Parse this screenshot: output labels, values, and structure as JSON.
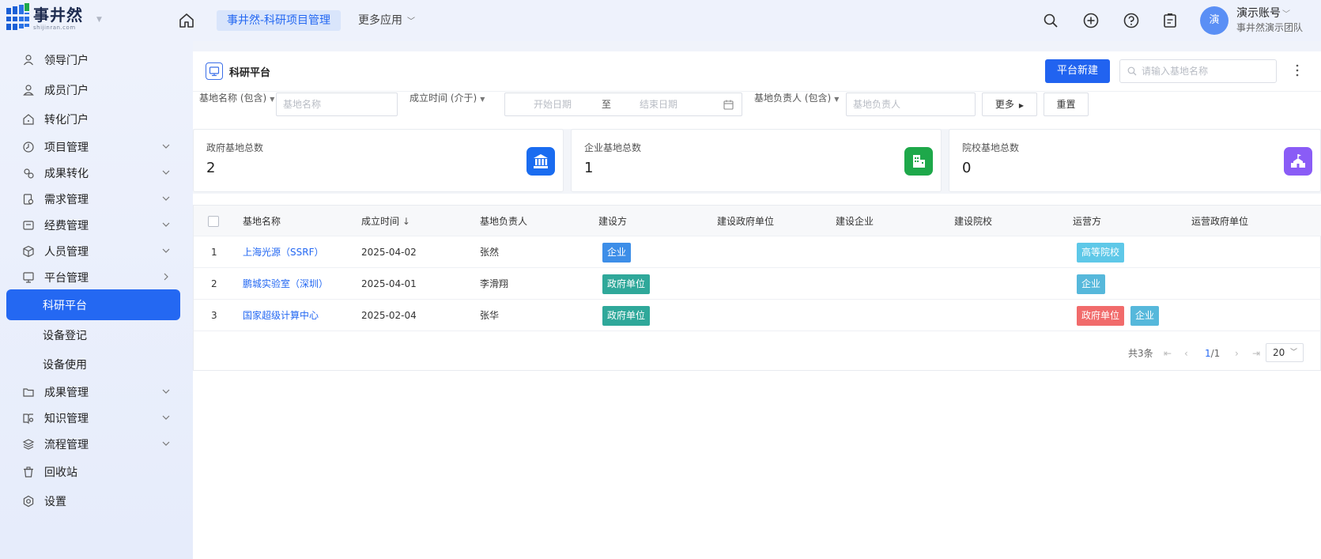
{
  "brand": {
    "name": "事井然",
    "domain": "shijinran.com",
    "accent": "#2468f2"
  },
  "header": {
    "app_tab": "事井然-科研项目管理",
    "more_apps": "更多应用",
    "icons": [
      "home-icon",
      "search-icon",
      "add-circle-icon",
      "help-icon",
      "task-list-icon"
    ],
    "avatar_text": "演",
    "account_name": "演示账号",
    "account_team": "事井然演示团队"
  },
  "sidebar": {
    "items": [
      {
        "label": "领导门户",
        "icon": "leader-icon"
      },
      {
        "label": "成员门户",
        "icon": "member-icon"
      },
      {
        "label": "转化门户",
        "icon": "transform-icon"
      },
      {
        "label": "项目管理",
        "icon": "project-icon",
        "expand": "down"
      },
      {
        "label": "成果转化",
        "icon": "achievement-transform-icon",
        "expand": "down"
      },
      {
        "label": "需求管理",
        "icon": "demand-icon",
        "expand": "down"
      },
      {
        "label": "经费管理",
        "icon": "funds-icon",
        "expand": "down"
      },
      {
        "label": "人员管理",
        "icon": "people-icon",
        "expand": "down"
      },
      {
        "label": "平台管理",
        "icon": "platform-icon",
        "expand": "right"
      },
      {
        "label": "科研平台",
        "sub": true,
        "active": true
      },
      {
        "label": "设备登记",
        "sub": true
      },
      {
        "label": "设备使用",
        "sub": true
      },
      {
        "label": "成果管理",
        "icon": "results-icon",
        "expand": "down"
      },
      {
        "label": "知识管理",
        "icon": "knowledge-icon",
        "expand": "down"
      },
      {
        "label": "流程管理",
        "icon": "workflow-icon",
        "expand": "down"
      },
      {
        "label": "回收站",
        "icon": "trash-icon"
      },
      {
        "label": "设置",
        "icon": "settings-icon"
      }
    ]
  },
  "page": {
    "title": "科研平台",
    "new_button": "平台新建",
    "search_placeholder": "请输入基地名称"
  },
  "filters": {
    "name_label": "基地名称 (包含)",
    "name_placeholder": "基地名称",
    "date_label": "成立时间 (介于)",
    "date_start": "开始日期",
    "date_sep": "至",
    "date_end": "结束日期",
    "leader_label": "基地负责人 (包含)",
    "leader_placeholder": "基地负责人",
    "more": "更多",
    "reset": "重置"
  },
  "stats": [
    {
      "label": "政府基地总数",
      "value": "2",
      "color": "#1a6cf0",
      "icon": "government-building-icon"
    },
    {
      "label": "企业基地总数",
      "value": "1",
      "color": "#1ea84a",
      "icon": "enterprise-building-icon"
    },
    {
      "label": "院校基地总数",
      "value": "0",
      "color": "#8a5cf6",
      "icon": "school-building-icon"
    }
  ],
  "table": {
    "columns": [
      "基地名称",
      "成立时间",
      "基地负责人",
      "建设方",
      "建设政府单位",
      "建设企业",
      "建设院校",
      "运营方",
      "运营政府单位"
    ],
    "sort_indicator": "↓",
    "rows": [
      {
        "idx": "1",
        "name": "上海光源（SSRF）",
        "date": "2025-04-02",
        "leader": "张然",
        "builder": [
          {
            "t": "企业",
            "c": "#3d8ee8"
          }
        ],
        "operator": [
          {
            "t": "高等院校",
            "c": "#5ec8e8"
          }
        ]
      },
      {
        "idx": "2",
        "name": "鹏城实验室（深圳）",
        "date": "2025-04-01",
        "leader": "李滑翔",
        "builder": [
          {
            "t": "政府单位",
            "c": "#2fa89a"
          }
        ],
        "operator": [
          {
            "t": "企业",
            "c": "#56b8db"
          }
        ]
      },
      {
        "idx": "3",
        "name": "国家超级计算中心",
        "date": "2025-02-04",
        "leader": "张华",
        "builder": [
          {
            "t": "政府单位",
            "c": "#2fa89a"
          }
        ],
        "operator": [
          {
            "t": "政府单位",
            "c": "#f16b6b"
          },
          {
            "t": "企业",
            "c": "#56b8db"
          }
        ]
      }
    ]
  },
  "pagination": {
    "total": "共3条",
    "page": "1",
    "pages": "/1",
    "size": "20"
  }
}
